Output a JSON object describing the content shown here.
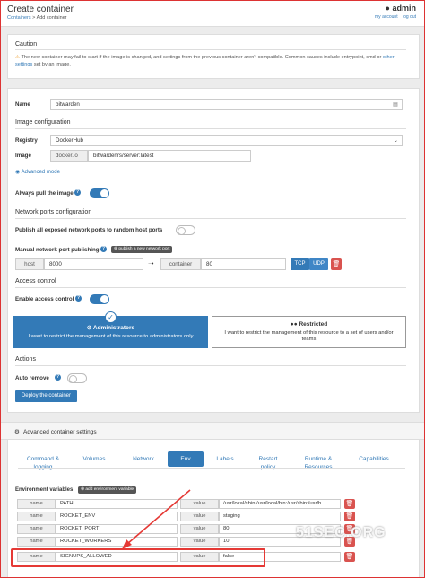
{
  "header": {
    "title": "Create container",
    "breadcrumb_root": "Containers",
    "breadcrumb_current": "> Add container",
    "user": "admin",
    "my_account": "my account",
    "log_out": "log out"
  },
  "caution": {
    "title": "Caution",
    "text_a": "The new container may fail to start if the image is changed, and settings from the previous container aren't compatible. Common causes include entrypoint, cmd or ",
    "link": "other settings",
    "text_b": " set by an image."
  },
  "name": {
    "label": "Name",
    "value": "bitwarden"
  },
  "image": {
    "section": "Image configuration",
    "registry_label": "Registry",
    "registry_value": "DockerHub",
    "image_label": "Image",
    "image_prefix": "docker.io",
    "image_value": "bitwardenrs/server:latest",
    "advanced": "Advanced mode",
    "always_pull": "Always pull the image",
    "always_pull_on": true
  },
  "ports": {
    "section": "Network ports configuration",
    "publish_all": "Publish all exposed network ports to random host ports",
    "publish_all_on": false,
    "manual": "Manual network port publishing",
    "add_button": "publish a new network port",
    "host_label": "host",
    "host_value": "8000",
    "container_label": "container",
    "container_value": "80",
    "tcp": "TCP",
    "udp": "UDP"
  },
  "access": {
    "section": "Access control",
    "enable": "Enable access control",
    "enable_on": true,
    "admin_title": "Administrators",
    "admin_desc": "I want to restrict the management of this resource to administrators only",
    "restricted_title": "Restricted",
    "restricted_desc": "I want to restrict the management of this resource to a set of users and/or teams"
  },
  "actions": {
    "section": "Actions",
    "auto_remove": "Auto remove",
    "auto_remove_on": false,
    "deploy": "Deploy the container"
  },
  "advanced": {
    "title": "Advanced container settings",
    "tabs": [
      "Command & logging",
      "Volumes",
      "Network",
      "Env",
      "Labels",
      "Restart policy",
      "Runtime & Resources",
      "Capabilities"
    ],
    "active_tab": "Env",
    "env_label": "Environment variables",
    "env_add": "add environment variable",
    "name_label": "name",
    "value_label": "value",
    "env": [
      {
        "name": "PATH",
        "value": "/usr/local/sbin:/usr/local/bin:/usr/sbin:/usr/b"
      },
      {
        "name": "ROCKET_ENV",
        "value": "staging"
      },
      {
        "name": "ROCKET_PORT",
        "value": "80"
      },
      {
        "name": "ROCKET_WORKERS",
        "value": "10"
      },
      {
        "name": "SIGNUPS_ALLOWED",
        "value": "false"
      }
    ]
  },
  "watermark": "51SEC.ORG",
  "colors": {
    "primary": "#337ab7",
    "danger": "#d9534f",
    "annotation": "#e53935"
  }
}
